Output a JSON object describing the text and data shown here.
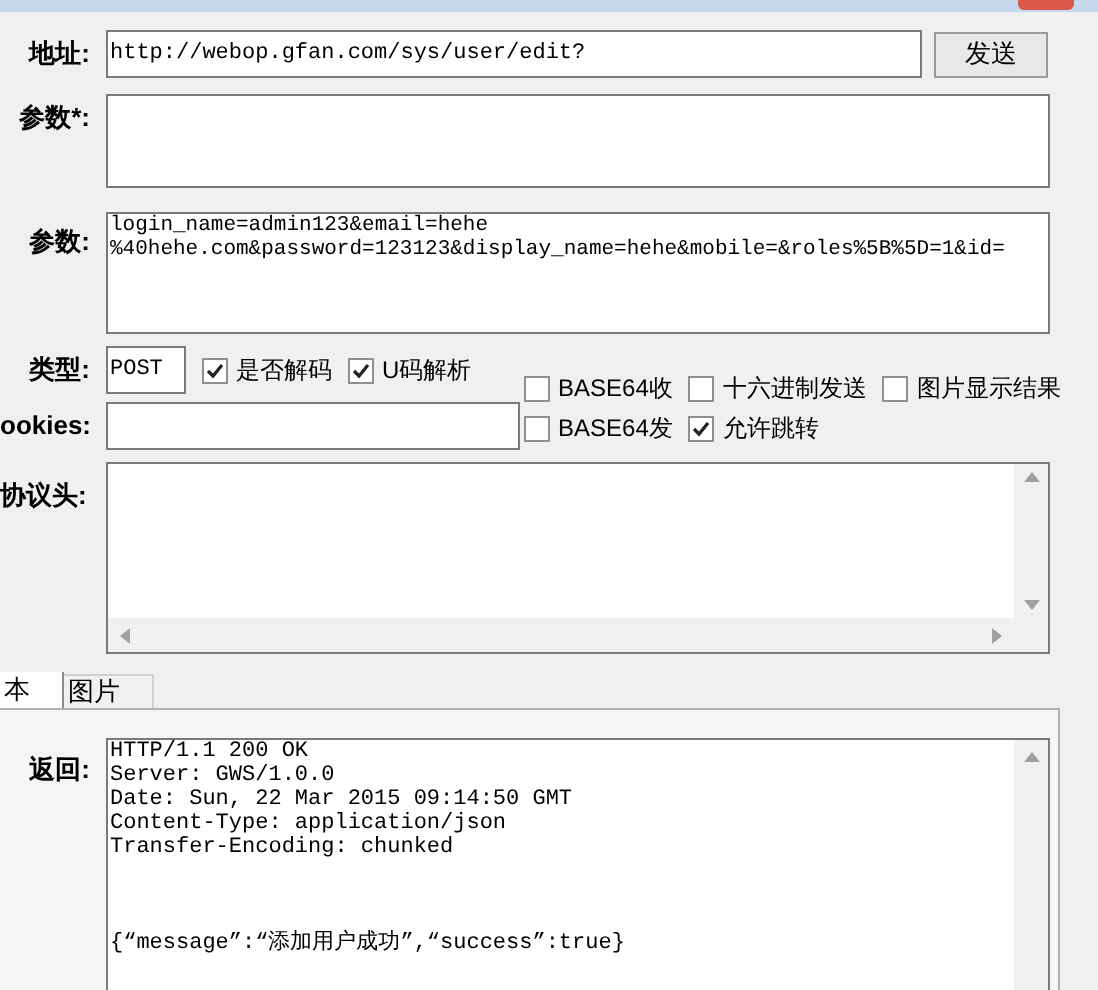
{
  "url_row": {
    "label": "地址:",
    "value": "http://webop.gfan.com/sys/user/edit?",
    "send_button": "发送"
  },
  "params_required": {
    "label": "参数*:"
  },
  "params": {
    "label": "参数:",
    "value": "login_name=admin123&email=hehe\n%40hehe.com&password=123123&display_name=hehe&mobile=&roles%5B%5D=1&id="
  },
  "type_row": {
    "label": "类型:",
    "value": "POST"
  },
  "left_options": [
    {
      "label": "是否解码",
      "checked": true
    },
    {
      "label": "U码解析",
      "checked": true
    }
  ],
  "right_options": [
    {
      "label": "BASE64收",
      "checked": false
    },
    {
      "label": "十六进制发送",
      "checked": false
    },
    {
      "label": "图片显示结果",
      "checked": false
    },
    {
      "label": "BASE64发",
      "checked": false
    },
    {
      "label": "允许跳转",
      "checked": true
    }
  ],
  "cookies": {
    "label": "ookies:"
  },
  "headers": {
    "label": "协议头:"
  },
  "tabs": [
    {
      "label": "本",
      "selected": true
    },
    {
      "label": "图片",
      "selected": false
    }
  ],
  "response": {
    "label": "返回:",
    "value": "HTTP/1.1 200 OK\nServer: GWS/1.0.0\nDate: Sun, 22 Mar 2015 09:14:50 GMT\nContent-Type: application/json\nTransfer-Encoding: chunked\n\n\n\n{“message”:“添加用户成功”,“success”:true}"
  }
}
